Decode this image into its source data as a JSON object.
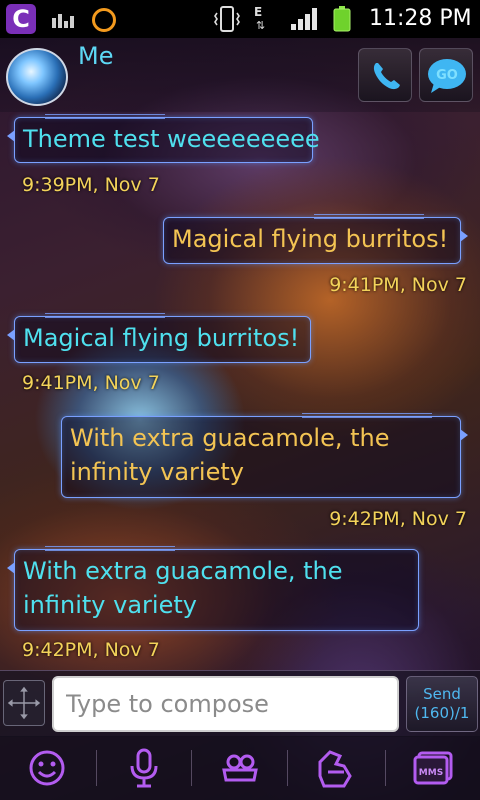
{
  "status_bar": {
    "app_icon_letter": "C",
    "network_type": "E",
    "time": "11:28 PM"
  },
  "header": {
    "contact_name": "Me",
    "call_icon": "phone-icon",
    "go_icon": "go-chat-icon",
    "go_label": "GO"
  },
  "messages": [
    {
      "direction": "incoming",
      "text": "Theme test weeeeeeeee",
      "timestamp": "9:39PM, Nov 7"
    },
    {
      "direction": "outgoing",
      "text": "Magical flying burritos!",
      "timestamp": "9:41PM, Nov 7"
    },
    {
      "direction": "incoming",
      "text": "Magical flying burritos!",
      "timestamp": "9:41PM, Nov 7"
    },
    {
      "direction": "outgoing",
      "text": "With extra guacamole, the infinity variety",
      "timestamp": "9:42PM, Nov 7"
    },
    {
      "direction": "incoming",
      "text": "With extra guacamole, the infinity variety",
      "timestamp": "9:42PM, Nov 7"
    }
  ],
  "compose": {
    "placeholder": "Type to compose",
    "value": "",
    "send_label": "Send",
    "char_counter": "(160)/1"
  },
  "toolbar": {
    "icons": [
      "smiley-icon",
      "microphone-icon",
      "gift-icon",
      "attachment-icon",
      "mms-icon"
    ],
    "mms_label": "MMS"
  },
  "colors": {
    "incoming_text": "#4fe0ee",
    "outgoing_text": "#f3c453",
    "timestamp": "#f3d35a",
    "bubble_border": "#7aa0ff",
    "toolbar_icon": "#b35cf0",
    "accent_blue": "#4fb8f0"
  }
}
